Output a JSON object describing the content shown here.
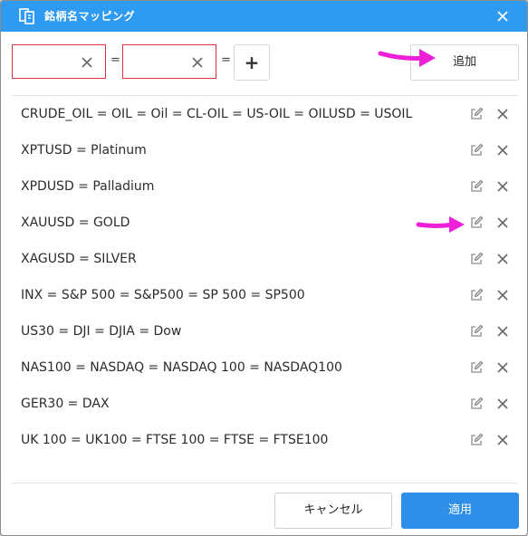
{
  "dialog": {
    "title": "銘柄名マッピング",
    "title_icon": "mapping-icon",
    "close_icon": "close-icon"
  },
  "editor": {
    "left_value": "",
    "right_value": "",
    "equals_1": "=",
    "equals_2": "=",
    "plus_label": "+",
    "add_label": "追加"
  },
  "mappings": [
    "CRUDE_OIL = OIL = Oil = CL-OIL = US-OIL = OILUSD = USOIL",
    "XPTUSD = Platinum",
    "XPDUSD = Palladium",
    "XAUUSD = GOLD",
    "XAGUSD = SILVER",
    "INX = S&P 500 = S&P500 = SP 500 = SP500",
    "US30 = DJI = DJIA = Dow",
    "NAS100 = NASDAQ = NASDAQ 100 = NASDAQ100",
    "GER30 = DAX",
    "UK 100 = UK100 = FTSE 100 = FTSE = FTSE100"
  ],
  "footer": {
    "cancel_label": "キャンセル",
    "apply_label": "適用"
  },
  "colors": {
    "titlebar": "#2f9bf0",
    "accent": "#2f8ee8",
    "input_border": "#e0303a",
    "annotation_arrow": "#ee1fd8"
  }
}
